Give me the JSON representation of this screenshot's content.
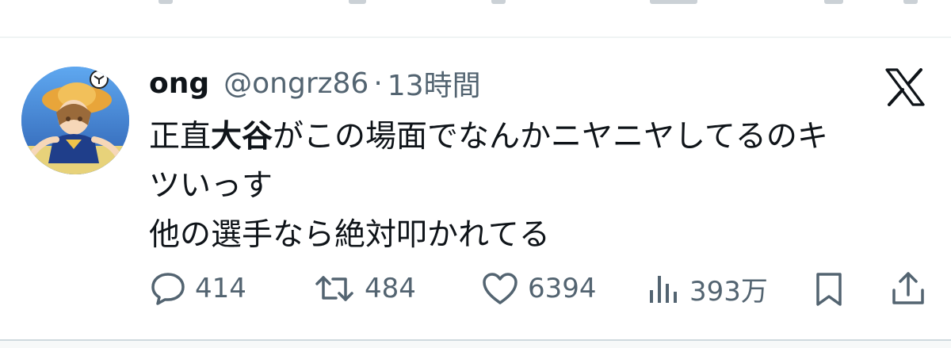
{
  "tweet": {
    "display_name": "ong",
    "handle": "@ongrz86",
    "separator": "·",
    "time": "13時間",
    "text_line1_pre": "正直",
    "text_line1_bold": "大谷",
    "text_line1_post": "がこの場面でなんかニヤニヤしてるのキ",
    "text_line2": "ツいっす",
    "text_line3": "他の選手なら絶対叩かれてる"
  },
  "actions": {
    "replies": "414",
    "retweets": "484",
    "likes": "6394",
    "views": "393万"
  },
  "icons": [
    "x-logo-icon",
    "reply-icon",
    "retweet-icon",
    "like-icon",
    "views-icon",
    "bookmark-icon",
    "share-icon"
  ],
  "colors": {
    "text": "#0f1419",
    "secondary": "#536471",
    "divider": "#eff3f4"
  }
}
